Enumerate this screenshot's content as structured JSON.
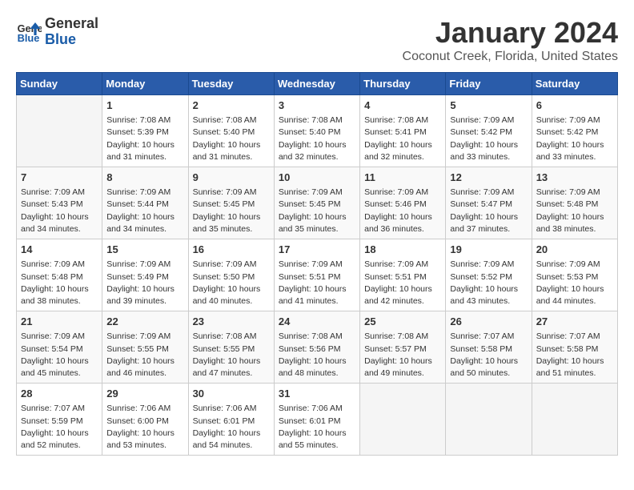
{
  "logo": {
    "line1": "General",
    "line2": "Blue"
  },
  "title": "January 2024",
  "subtitle": "Coconut Creek, Florida, United States",
  "days_of_week": [
    "Sunday",
    "Monday",
    "Tuesday",
    "Wednesday",
    "Thursday",
    "Friday",
    "Saturday"
  ],
  "weeks": [
    [
      {
        "day": "",
        "content": ""
      },
      {
        "day": "1",
        "content": "Sunrise: 7:08 AM\nSunset: 5:39 PM\nDaylight: 10 hours\nand 31 minutes."
      },
      {
        "day": "2",
        "content": "Sunrise: 7:08 AM\nSunset: 5:40 PM\nDaylight: 10 hours\nand 31 minutes."
      },
      {
        "day": "3",
        "content": "Sunrise: 7:08 AM\nSunset: 5:40 PM\nDaylight: 10 hours\nand 32 minutes."
      },
      {
        "day": "4",
        "content": "Sunrise: 7:08 AM\nSunset: 5:41 PM\nDaylight: 10 hours\nand 32 minutes."
      },
      {
        "day": "5",
        "content": "Sunrise: 7:09 AM\nSunset: 5:42 PM\nDaylight: 10 hours\nand 33 minutes."
      },
      {
        "day": "6",
        "content": "Sunrise: 7:09 AM\nSunset: 5:42 PM\nDaylight: 10 hours\nand 33 minutes."
      }
    ],
    [
      {
        "day": "7",
        "content": "Sunrise: 7:09 AM\nSunset: 5:43 PM\nDaylight: 10 hours\nand 34 minutes."
      },
      {
        "day": "8",
        "content": "Sunrise: 7:09 AM\nSunset: 5:44 PM\nDaylight: 10 hours\nand 34 minutes."
      },
      {
        "day": "9",
        "content": "Sunrise: 7:09 AM\nSunset: 5:45 PM\nDaylight: 10 hours\nand 35 minutes."
      },
      {
        "day": "10",
        "content": "Sunrise: 7:09 AM\nSunset: 5:45 PM\nDaylight: 10 hours\nand 35 minutes."
      },
      {
        "day": "11",
        "content": "Sunrise: 7:09 AM\nSunset: 5:46 PM\nDaylight: 10 hours\nand 36 minutes."
      },
      {
        "day": "12",
        "content": "Sunrise: 7:09 AM\nSunset: 5:47 PM\nDaylight: 10 hours\nand 37 minutes."
      },
      {
        "day": "13",
        "content": "Sunrise: 7:09 AM\nSunset: 5:48 PM\nDaylight: 10 hours\nand 38 minutes."
      }
    ],
    [
      {
        "day": "14",
        "content": "Sunrise: 7:09 AM\nSunset: 5:48 PM\nDaylight: 10 hours\nand 38 minutes."
      },
      {
        "day": "15",
        "content": "Sunrise: 7:09 AM\nSunset: 5:49 PM\nDaylight: 10 hours\nand 39 minutes."
      },
      {
        "day": "16",
        "content": "Sunrise: 7:09 AM\nSunset: 5:50 PM\nDaylight: 10 hours\nand 40 minutes."
      },
      {
        "day": "17",
        "content": "Sunrise: 7:09 AM\nSunset: 5:51 PM\nDaylight: 10 hours\nand 41 minutes."
      },
      {
        "day": "18",
        "content": "Sunrise: 7:09 AM\nSunset: 5:51 PM\nDaylight: 10 hours\nand 42 minutes."
      },
      {
        "day": "19",
        "content": "Sunrise: 7:09 AM\nSunset: 5:52 PM\nDaylight: 10 hours\nand 43 minutes."
      },
      {
        "day": "20",
        "content": "Sunrise: 7:09 AM\nSunset: 5:53 PM\nDaylight: 10 hours\nand 44 minutes."
      }
    ],
    [
      {
        "day": "21",
        "content": "Sunrise: 7:09 AM\nSunset: 5:54 PM\nDaylight: 10 hours\nand 45 minutes."
      },
      {
        "day": "22",
        "content": "Sunrise: 7:09 AM\nSunset: 5:55 PM\nDaylight: 10 hours\nand 46 minutes."
      },
      {
        "day": "23",
        "content": "Sunrise: 7:08 AM\nSunset: 5:55 PM\nDaylight: 10 hours\nand 47 minutes."
      },
      {
        "day": "24",
        "content": "Sunrise: 7:08 AM\nSunset: 5:56 PM\nDaylight: 10 hours\nand 48 minutes."
      },
      {
        "day": "25",
        "content": "Sunrise: 7:08 AM\nSunset: 5:57 PM\nDaylight: 10 hours\nand 49 minutes."
      },
      {
        "day": "26",
        "content": "Sunrise: 7:07 AM\nSunset: 5:58 PM\nDaylight: 10 hours\nand 50 minutes."
      },
      {
        "day": "27",
        "content": "Sunrise: 7:07 AM\nSunset: 5:58 PM\nDaylight: 10 hours\nand 51 minutes."
      }
    ],
    [
      {
        "day": "28",
        "content": "Sunrise: 7:07 AM\nSunset: 5:59 PM\nDaylight: 10 hours\nand 52 minutes."
      },
      {
        "day": "29",
        "content": "Sunrise: 7:06 AM\nSunset: 6:00 PM\nDaylight: 10 hours\nand 53 minutes."
      },
      {
        "day": "30",
        "content": "Sunrise: 7:06 AM\nSunset: 6:01 PM\nDaylight: 10 hours\nand 54 minutes."
      },
      {
        "day": "31",
        "content": "Sunrise: 7:06 AM\nSunset: 6:01 PM\nDaylight: 10 hours\nand 55 minutes."
      },
      {
        "day": "",
        "content": ""
      },
      {
        "day": "",
        "content": ""
      },
      {
        "day": "",
        "content": ""
      }
    ]
  ]
}
